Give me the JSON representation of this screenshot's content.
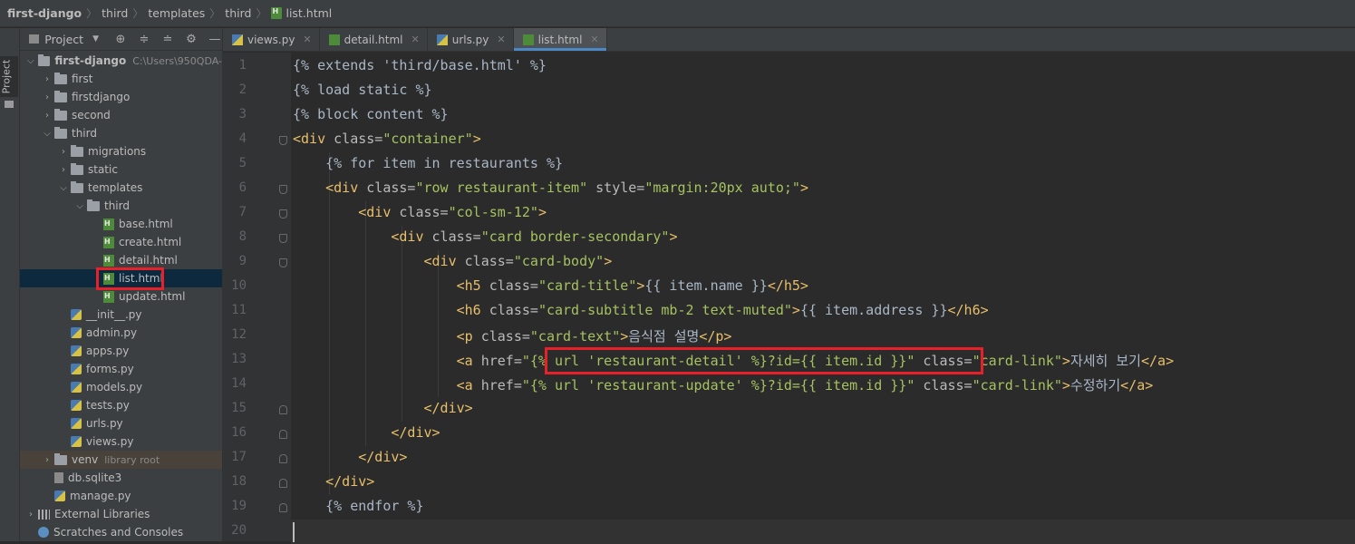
{
  "breadcrumb": {
    "items": [
      "first-django",
      "third",
      "templates",
      "third",
      "list.html"
    ]
  },
  "toolstrip": {
    "project_label": "Project"
  },
  "project_panel": {
    "title": "Project",
    "tree": [
      {
        "name": "first-django",
        "path": "C:\\Users\\950QDA-",
        "kind": "folder",
        "open": true
      },
      {
        "name": "first",
        "kind": "folder",
        "open": false
      },
      {
        "name": "firstdjango",
        "kind": "folder",
        "open": false
      },
      {
        "name": "second",
        "kind": "folder",
        "open": false
      },
      {
        "name": "third",
        "kind": "folder",
        "open": true
      },
      {
        "name": "migrations",
        "kind": "folder",
        "open": false
      },
      {
        "name": "static",
        "kind": "folder",
        "open": false
      },
      {
        "name": "templates",
        "kind": "folder",
        "open": true
      },
      {
        "name": "third",
        "kind": "folder",
        "open": true
      },
      {
        "name": "base.html",
        "kind": "html"
      },
      {
        "name": "create.html",
        "kind": "html"
      },
      {
        "name": "detail.html",
        "kind": "html"
      },
      {
        "name": "list.html",
        "kind": "html",
        "selected": true
      },
      {
        "name": "update.html",
        "kind": "html"
      },
      {
        "name": "__init__.py",
        "kind": "py"
      },
      {
        "name": "admin.py",
        "kind": "py"
      },
      {
        "name": "apps.py",
        "kind": "py"
      },
      {
        "name": "forms.py",
        "kind": "py"
      },
      {
        "name": "models.py",
        "kind": "py"
      },
      {
        "name": "tests.py",
        "kind": "py"
      },
      {
        "name": "urls.py",
        "kind": "py"
      },
      {
        "name": "views.py",
        "kind": "py"
      },
      {
        "name": "venv",
        "path": "library root",
        "kind": "folder",
        "open": false
      },
      {
        "name": "db.sqlite3",
        "kind": "db"
      },
      {
        "name": "manage.py",
        "kind": "py"
      },
      {
        "name": "External Libraries",
        "kind": "lib",
        "open": false
      },
      {
        "name": "Scratches and Consoles",
        "kind": "scratch"
      }
    ]
  },
  "tabs": [
    {
      "label": "views.py",
      "kind": "py",
      "active": false
    },
    {
      "label": "detail.html",
      "kind": "html",
      "active": false
    },
    {
      "label": "urls.py",
      "kind": "py",
      "active": false
    },
    {
      "label": "list.html",
      "kind": "html",
      "active": true
    }
  ],
  "editor": {
    "lines": [
      [
        [
          "tpl",
          "{% extends 'third/base.html' %}"
        ]
      ],
      [
        [
          "tpl",
          "{% load static %}"
        ]
      ],
      [
        [
          "tpl",
          "{% block content %}"
        ]
      ],
      [
        [
          "tag",
          "<div "
        ],
        [
          "attr",
          "class="
        ],
        [
          "str",
          "\"container\""
        ],
        [
          "tag",
          ">"
        ]
      ],
      [
        [
          "txt",
          "    "
        ],
        [
          "tpl",
          "{% for item in restaurants %}"
        ]
      ],
      [
        [
          "txt",
          "    "
        ],
        [
          "tag",
          "<div "
        ],
        [
          "attr",
          "class="
        ],
        [
          "str",
          "\"row restaurant-item\" "
        ],
        [
          "attr",
          "style="
        ],
        [
          "str",
          "\"margin:20px auto;\""
        ],
        [
          "tag",
          ">"
        ]
      ],
      [
        [
          "txt",
          "        "
        ],
        [
          "tag",
          "<div "
        ],
        [
          "attr",
          "class="
        ],
        [
          "str",
          "\"col-sm-12\""
        ],
        [
          "tag",
          ">"
        ]
      ],
      [
        [
          "txt",
          "            "
        ],
        [
          "tag",
          "<div "
        ],
        [
          "attr",
          "class="
        ],
        [
          "str",
          "\"card border-secondary\""
        ],
        [
          "tag",
          ">"
        ]
      ],
      [
        [
          "txt",
          "                "
        ],
        [
          "tag",
          "<div "
        ],
        [
          "attr",
          "class="
        ],
        [
          "str",
          "\"card-body\""
        ],
        [
          "tag",
          ">"
        ]
      ],
      [
        [
          "txt",
          "                    "
        ],
        [
          "tag",
          "<h5 "
        ],
        [
          "attr",
          "class="
        ],
        [
          "str",
          "\"card-title\""
        ],
        [
          "tag",
          ">"
        ],
        [
          "txt",
          "{{ item.name }}"
        ],
        [
          "tag",
          "</h5>"
        ]
      ],
      [
        [
          "txt",
          "                    "
        ],
        [
          "tag",
          "<h6 "
        ],
        [
          "attr",
          "class="
        ],
        [
          "str",
          "\"card-subtitle mb-2 text-muted\""
        ],
        [
          "tag",
          ">"
        ],
        [
          "txt",
          "{{ item.address }}"
        ],
        [
          "tag",
          "</h6>"
        ]
      ],
      [
        [
          "txt",
          "                    "
        ],
        [
          "tag",
          "<p "
        ],
        [
          "attr",
          "class="
        ],
        [
          "str",
          "\"card-text\""
        ],
        [
          "tag",
          ">"
        ],
        [
          "txt",
          "음식점 설명"
        ],
        [
          "tag",
          "</p>"
        ]
      ],
      [
        [
          "txt",
          "                    "
        ],
        [
          "tag",
          "<a "
        ],
        [
          "attr",
          "href="
        ],
        [
          "str",
          "\"{% url 'restaurant-detail' %}?id={{ item.id }}\" "
        ],
        [
          "attr",
          "class="
        ],
        [
          "str",
          "\"card-link\""
        ],
        [
          "tag",
          ">"
        ],
        [
          "txt",
          "자세히 보기"
        ],
        [
          "tag",
          "</a>"
        ]
      ],
      [
        [
          "txt",
          "                    "
        ],
        [
          "tag",
          "<a "
        ],
        [
          "attr",
          "href="
        ],
        [
          "str",
          "\"{% url 'restaurant-update' %}?id={{ item.id }}\" "
        ],
        [
          "attr",
          "class="
        ],
        [
          "str",
          "\"card-link\""
        ],
        [
          "tag",
          ">"
        ],
        [
          "txt",
          "수정하기"
        ],
        [
          "tag",
          "</a>"
        ]
      ],
      [
        [
          "txt",
          "                "
        ],
        [
          "tag",
          "</div>"
        ]
      ],
      [
        [
          "txt",
          "            "
        ],
        [
          "tag",
          "</div>"
        ]
      ],
      [
        [
          "txt",
          "        "
        ],
        [
          "tag",
          "</div>"
        ]
      ],
      [
        [
          "txt",
          "    "
        ],
        [
          "tag",
          "</div>"
        ]
      ],
      [
        [
          "txt",
          "    "
        ],
        [
          "tpl",
          "{% endfor %}"
        ]
      ],
      [
        [
          "txt",
          ""
        ]
      ]
    ]
  },
  "colors": {
    "highlight_box": "#e8202a",
    "tag": "#e8bf6a",
    "string": "#a5c261",
    "text": "#a9b7c6"
  }
}
